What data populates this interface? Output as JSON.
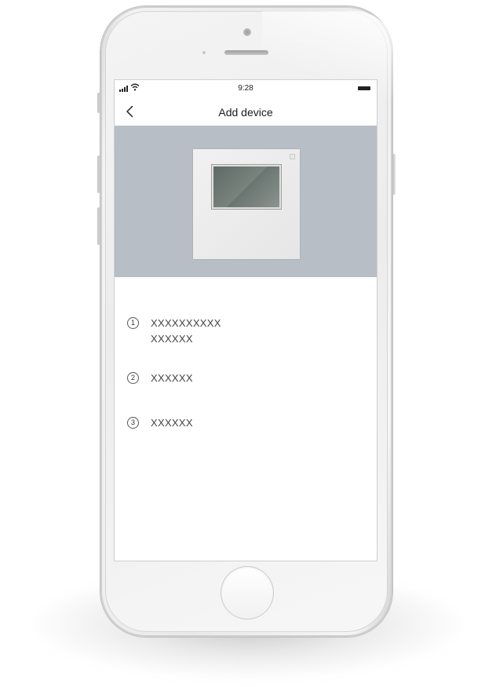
{
  "status_bar": {
    "time": "9:28",
    "signal_icon": "cellular-signal-icon",
    "wifi_icon": "wifi-icon",
    "battery_icon": "battery-icon"
  },
  "nav": {
    "back_icon": "chevron-left-icon",
    "title": "Add device"
  },
  "banner": {
    "background_color": "#b8bec5",
    "device_icon": "thermostat-controller-icon"
  },
  "steps": [
    {
      "number": "1",
      "lines": [
        "XXXXXXXXXX",
        "XXXXXX"
      ]
    },
    {
      "number": "2",
      "lines": [
        "XXXXXX"
      ]
    },
    {
      "number": "3",
      "lines": [
        "XXXXXX"
      ]
    }
  ],
  "hardware": {
    "home_button_icon": "home-button"
  }
}
